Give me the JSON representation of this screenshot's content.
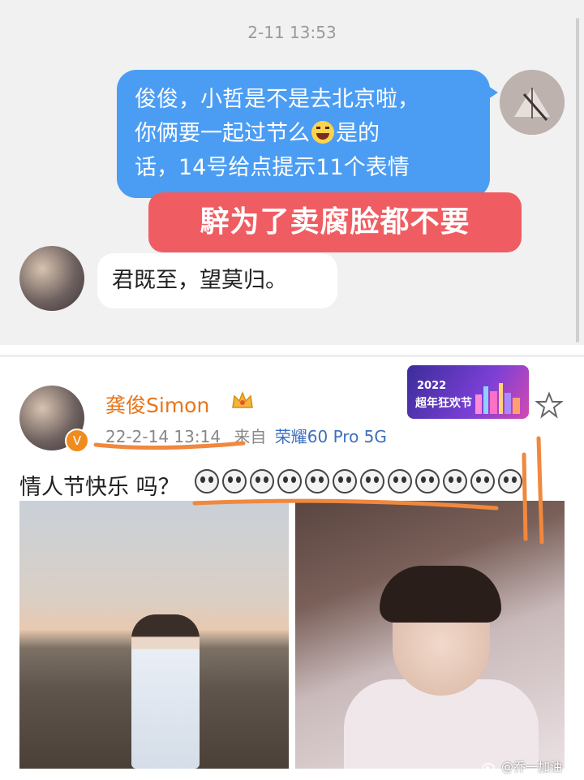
{
  "chat": {
    "timestamp": "2-11 13:53",
    "outgoing_lines": [
      "俊俊，小哲是不是去北京啦，",
      "你俩要一起过节么",
      "是的",
      "话，14号给点提示11个表情"
    ],
    "overlay_caption": "騂为了卖腐脸都不要",
    "reply": "君既至，望莫归。"
  },
  "post": {
    "username": "龚俊Simon",
    "timestamp": "22-2-14 13:14",
    "source_prefix": "来自",
    "device": "荣耀60 Pro 5G",
    "text": "情人节快乐 吗？",
    "emoji_count": 12,
    "promo_year": "2022",
    "promo_text": "超年狂欢节"
  },
  "watermark": "@乔一加油",
  "colors": {
    "bubble_blue": "#4b9df4",
    "overlay_red": "#ef5d62",
    "username_orange": "#e8751a",
    "annotation_orange": "#f0883e",
    "device_blue": "#3b6fbf"
  },
  "icons": [
    "fan-avatar-icon",
    "crown-icon",
    "star-icon",
    "verified-icon",
    "laugh-emoji-icon",
    "weibo-logo-icon"
  ]
}
